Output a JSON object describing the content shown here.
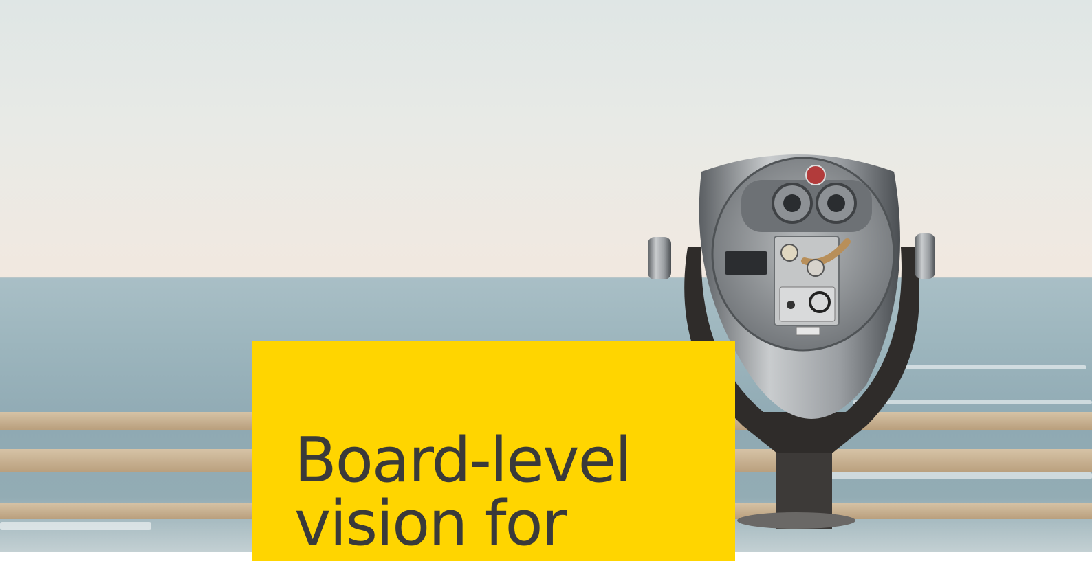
{
  "hero": {
    "image": "tower-viewer-binoculars-by-the-sea",
    "card_color": "#ffd500",
    "headline_line1": "Board-level",
    "headline_line2": "vision for"
  }
}
